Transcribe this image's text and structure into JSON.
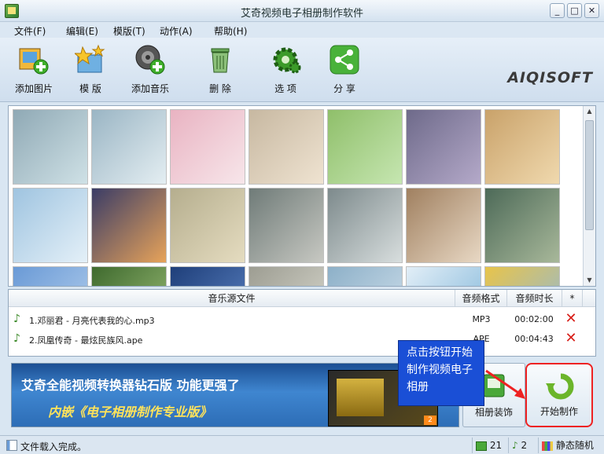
{
  "window": {
    "title": "艾奇视频电子相册制作软件",
    "min": "_",
    "max": "□",
    "close": "✕"
  },
  "menu": [
    "文件(F)",
    "编辑(E)",
    "模版(T)",
    "动作(A)",
    "帮助(H)"
  ],
  "toolbar": [
    {
      "label": "添加图片",
      "icon": "add-image-icon"
    },
    {
      "label": "模 版",
      "icon": "template-icon"
    },
    {
      "label": "添加音乐",
      "icon": "add-music-icon"
    },
    {
      "label": "删 除",
      "icon": "trash-icon"
    },
    {
      "label": "选 项",
      "icon": "gear-icon"
    },
    {
      "label": "分 享",
      "icon": "share-icon"
    }
  ],
  "logo": "AIQISOFT",
  "thumbnails": {
    "icon": "photo-thumbnail",
    "count_visible": 21,
    "colors": [
      [
        "#8fa9b5",
        "#cfe1e6"
      ],
      [
        "#9ab5c4",
        "#e4eef2"
      ],
      [
        "#e9b3c2",
        "#f7e6ea"
      ],
      [
        "#c7b8a1",
        "#efe3d1"
      ],
      [
        "#8fbf6a",
        "#c6e6b1"
      ],
      [
        "#6e6a8a",
        "#b4a9c9"
      ],
      [
        "#c9a26a",
        "#f0d9ae"
      ],
      [
        "#9fc4e0",
        "#e4f0f8"
      ],
      [
        "#3a3c66",
        "#e7a35a"
      ],
      [
        "#b5ae8e",
        "#e5dcc0"
      ],
      [
        "#6f7b78",
        "#c7c8c2"
      ],
      [
        "#7d8a8c",
        "#d8dede"
      ],
      [
        "#a08060",
        "#e8d8c4"
      ],
      [
        "#4d6a58",
        "#a8b89a"
      ],
      [
        "#6a9ad6",
        "#b8d2ee"
      ],
      [
        "#3f6a2e",
        "#9ec07a"
      ],
      [
        "#1f3f7a",
        "#5e86c6"
      ],
      [
        "#9d9d92",
        "#dcdcd2"
      ],
      [
        "#8db0c8",
        "#d4e3ee"
      ],
      [
        "#e2eef7",
        "#7cb4d8"
      ],
      [
        "#e8c44a",
        "#8bb8e0"
      ]
    ]
  },
  "music_table": {
    "headers": [
      "音乐源文件",
      "音频格式",
      "音频时长",
      "*"
    ],
    "rows": [
      {
        "name": "1.邓丽君 - 月亮代表我的心.mp3",
        "format": "MP3",
        "duration": "00:02:00"
      },
      {
        "name": "2.凤凰传奇 - 最炫民族风.ape",
        "format": "APE",
        "duration": "00:04:43"
      }
    ],
    "note_icon": "music-note-icon",
    "delete_icon": "delete-x-icon"
  },
  "banner": {
    "line1": "艾奇全能视频转换器钻石版  功能更强了",
    "line2": "内嵌《电子相册制作专业版》",
    "page": "2"
  },
  "callout": "点击按钮开始制作视频电子相册",
  "buttons": {
    "decorate": "相册装饰",
    "start": "开始制作"
  },
  "status": {
    "text": "文件载入完成。",
    "image_count": "21",
    "music_count": "2",
    "mode": "静态随机"
  }
}
